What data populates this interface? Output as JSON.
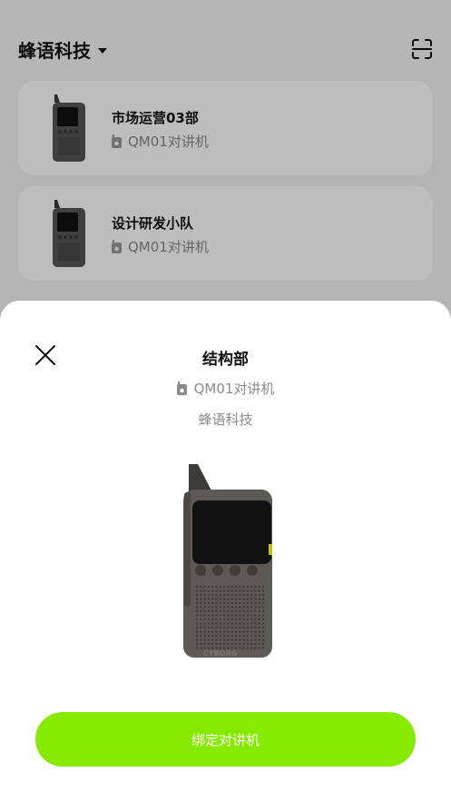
{
  "header": {
    "org_name": "蜂语科技",
    "caret_icon": "caret-down-icon",
    "scan_icon": "scan-icon"
  },
  "devices": [
    {
      "name": "市场运营03部",
      "model": "QM01对讲机",
      "icon": "walkie-talkie-icon"
    },
    {
      "name": "设计研发小队",
      "model": "QM01对讲机",
      "icon": "walkie-talkie-icon"
    }
  ],
  "sheet": {
    "title": "结构部",
    "model": "QM01对讲机",
    "org": "蜂语科技",
    "close_icon": "close-icon",
    "button_label": "绑定对讲机",
    "brand_print": "CYBORG",
    "accent_color": "#86e900"
  }
}
